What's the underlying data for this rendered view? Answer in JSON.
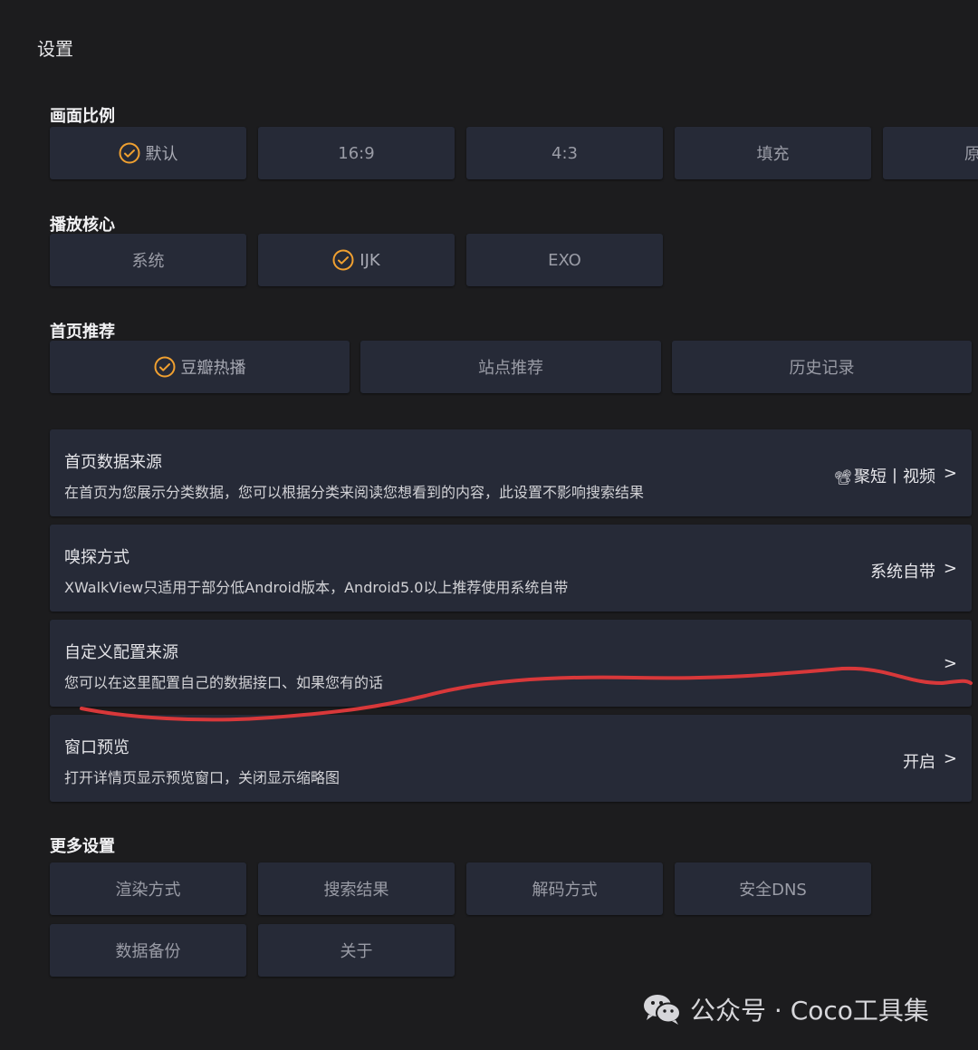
{
  "page": {
    "title": "设置"
  },
  "aspect_ratio": {
    "title": "画面比例",
    "options": [
      {
        "label": "默认",
        "selected": true
      },
      {
        "label": "16:9",
        "selected": false
      },
      {
        "label": "4:3",
        "selected": false
      },
      {
        "label": "填充",
        "selected": false
      },
      {
        "label": "原",
        "selected": false
      }
    ]
  },
  "player_core": {
    "title": "播放核心",
    "options": [
      {
        "label": "系统",
        "selected": false
      },
      {
        "label": "IJK",
        "selected": true
      },
      {
        "label": "EXO",
        "selected": false
      }
    ]
  },
  "home_recommend": {
    "title": "首页推荐",
    "options": [
      {
        "label": "豆瓣热播",
        "selected": true
      },
      {
        "label": "站点推荐",
        "selected": false
      },
      {
        "label": "历史记录",
        "selected": false
      }
    ]
  },
  "settings_rows": [
    {
      "title": "首页数据来源",
      "desc": "在首页为您展示分类数据，您可以根据分类来阅读您想看到的内容，此设置不影响搜索结果",
      "value": "聚短丨视频",
      "icon": "film-camera-icon",
      "chevron": ">"
    },
    {
      "title": "嗅探方式",
      "desc": "XWalkView只适用于部分低Android版本，Android5.0以上推荐使用系统自带",
      "value": "系统自带",
      "chevron": ">"
    },
    {
      "title": "自定义配置来源",
      "desc": "您可以在这里配置自己的数据接口、如果您有的话",
      "value": "",
      "chevron": ">"
    },
    {
      "title": "窗口预览",
      "desc": "打开详情页显示预览窗口，关闭显示缩略图",
      "value": "开启",
      "chevron": ">"
    }
  ],
  "more_settings": {
    "title": "更多设置",
    "buttons": [
      "渲染方式",
      "搜索结果",
      "解码方式",
      "安全DNS",
      "数据备份",
      "关于"
    ]
  },
  "watermark": {
    "text": "公众号 · Coco工具集",
    "icon": "wechat-icon"
  },
  "colors": {
    "accent": "#f0a030",
    "annotation": "#d8383a",
    "card": "#262a37",
    "background": "#1c1c1e"
  }
}
